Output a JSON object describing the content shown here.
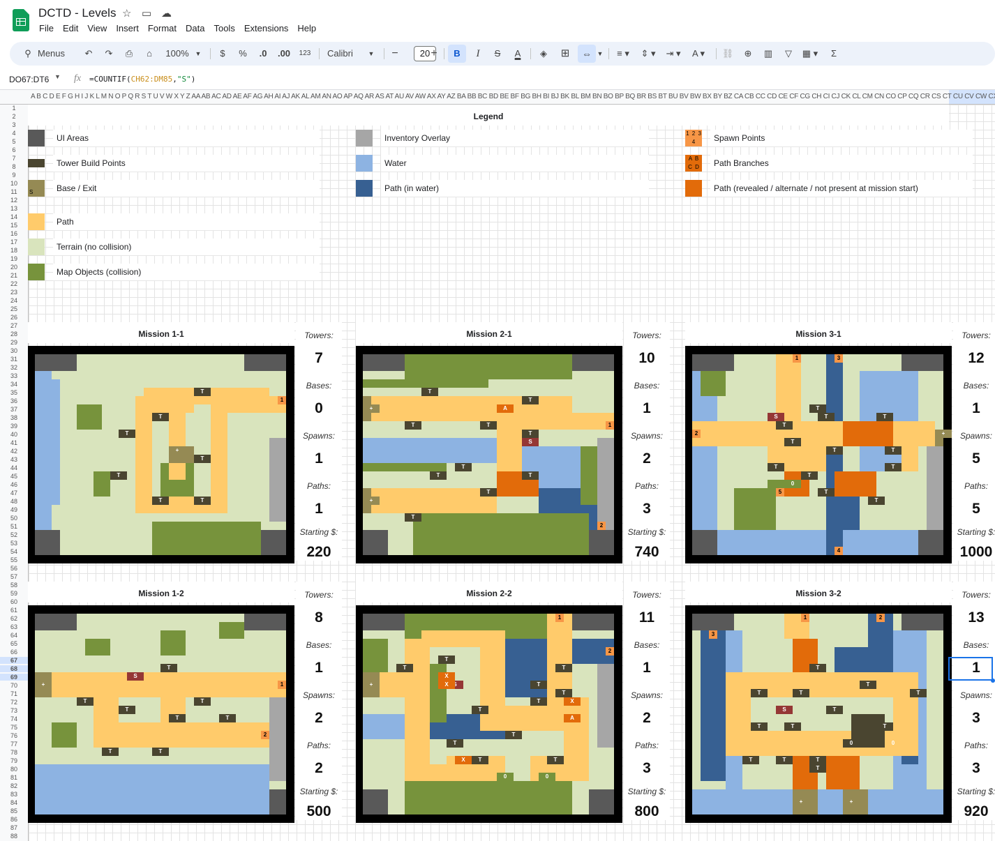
{
  "app": {
    "title": "DCTD - Levels"
  },
  "menu": [
    "File",
    "Edit",
    "View",
    "Insert",
    "Format",
    "Data",
    "Tools",
    "Extensions",
    "Help"
  ],
  "toolbar": {
    "search": "Menus",
    "zoom": "100%",
    "currency": "$",
    "percent": "%",
    "dec_down": ".0",
    "dec_up": ".00",
    "number_format": "123",
    "font": "Calibri",
    "font_size": "20"
  },
  "formula_bar": {
    "name_box": "DO67:DT6",
    "formula_prefix": "=COUNTIF(",
    "formula_ref": "CH62:DM85",
    "formula_comma": ",",
    "formula_str": "\"S\"",
    "formula_suffix": ")"
  },
  "col_headers": "A B C D E F G H I J K L M N O P Q R S T U V W X Y Z AA AB AC AD AE AF AG AH AI AJ AK AL AM AN AO AP AQ AR AS AT AU AV AW AX AY AZ BA BB BC BD BE BF BG BH BI BJ BK BL BM BN BO BP BQ BR BS BT BU BV BW BX BY BZ CA CB CC CD CE CF CG CH CI CJ CK CL CM CN CO CP CQ CR CS CT CU CV CW CX CY CZ DA DB DC DD DE DF DG DH DI DJ DK DL DM DN DO DP DQ DR DS DT",
  "legend": {
    "title": "Legend",
    "items": [
      {
        "label": "UI Areas",
        "color": "#595959"
      },
      {
        "label": "Tower Build Points",
        "color": "#4a4530"
      },
      {
        "label": "Base / Exit",
        "color": "#958a54",
        "mark": "S"
      },
      {
        "label": "Path",
        "color": "#ffcb6b"
      },
      {
        "label": "Terrain (no collision)",
        "color": "#d9e4bd"
      },
      {
        "label": "Map Objects (collision)",
        "color": "#77933c"
      },
      {
        "label": "Inventory Overlay",
        "color": "#a6a6a6"
      },
      {
        "label": "Water",
        "color": "#8db3e2"
      },
      {
        "label": "Path (in water)",
        "color": "#376092"
      },
      {
        "label": "Spawn Points",
        "color": "#f79646",
        "mark": "1 2 3 4"
      },
      {
        "label": "Path Branches",
        "color": "#e26b0a",
        "mark": "A B C D"
      },
      {
        "label": "Path (revealed / alternate / not present at mission start)",
        "color": "#e26b0a"
      }
    ]
  },
  "stat_labels": {
    "towers": "Towers:",
    "bases": "Bases:",
    "spawns": "Spawns:",
    "paths": "Paths:",
    "starting": "Starting $:"
  },
  "missions": [
    {
      "title": "Mission 1-1",
      "towers": "7",
      "bases": "0",
      "spawns": "1",
      "paths": "1",
      "starting": "220"
    },
    {
      "title": "Mission 2-1",
      "towers": "10",
      "bases": "1",
      "spawns": "2",
      "paths": "3",
      "starting": "740"
    },
    {
      "title": "Mission 3-1",
      "towers": "12",
      "bases": "1",
      "spawns": "5",
      "paths": "5",
      "starting": "1000"
    },
    {
      "title": "Mission 1-2",
      "towers": "8",
      "bases": "1",
      "spawns": "2",
      "paths": "2",
      "starting": "500"
    },
    {
      "title": "Mission 2-2",
      "towers": "11",
      "bases": "1",
      "spawns": "2",
      "paths": "3",
      "starting": "800"
    },
    {
      "title": "Mission 3-2",
      "towers": "13",
      "bases": "1",
      "spawns": "3",
      "paths": "3",
      "starting": "920"
    }
  ],
  "map_colors": {
    "ui": "#595959",
    "terrain": "#d9e4bd",
    "object": "#77933c",
    "path": "#ffcb6b",
    "water": "#8db3e2",
    "water_path": "#376092",
    "alt_path": "#e26b0a",
    "spawn": "#f79646",
    "tower": "#4a4530",
    "base": "#958a54",
    "inventory": "#a6a6a6",
    "special": "#953735"
  },
  "map_markers": {
    "tower": "T",
    "base": "+",
    "special": "S",
    "spawn_labels": [
      "1",
      "2",
      "3",
      "4",
      "5"
    ],
    "branch": "A",
    "blocked": "X",
    "zero": "0"
  },
  "icons": [
    "star-icon",
    "move-folder-icon",
    "cloud-status-icon",
    "search-icon",
    "undo-icon",
    "redo-icon",
    "print-icon",
    "paint-format-icon",
    "bold-icon",
    "italic-icon",
    "strikethrough-icon",
    "text-color-icon",
    "fill-color-icon",
    "borders-icon",
    "merge-cells-icon",
    "align-icon",
    "valign-icon",
    "wrap-icon",
    "rotate-icon",
    "link-icon",
    "comment-icon",
    "chart-icon",
    "filter-icon",
    "table-icon",
    "functions-icon"
  ]
}
